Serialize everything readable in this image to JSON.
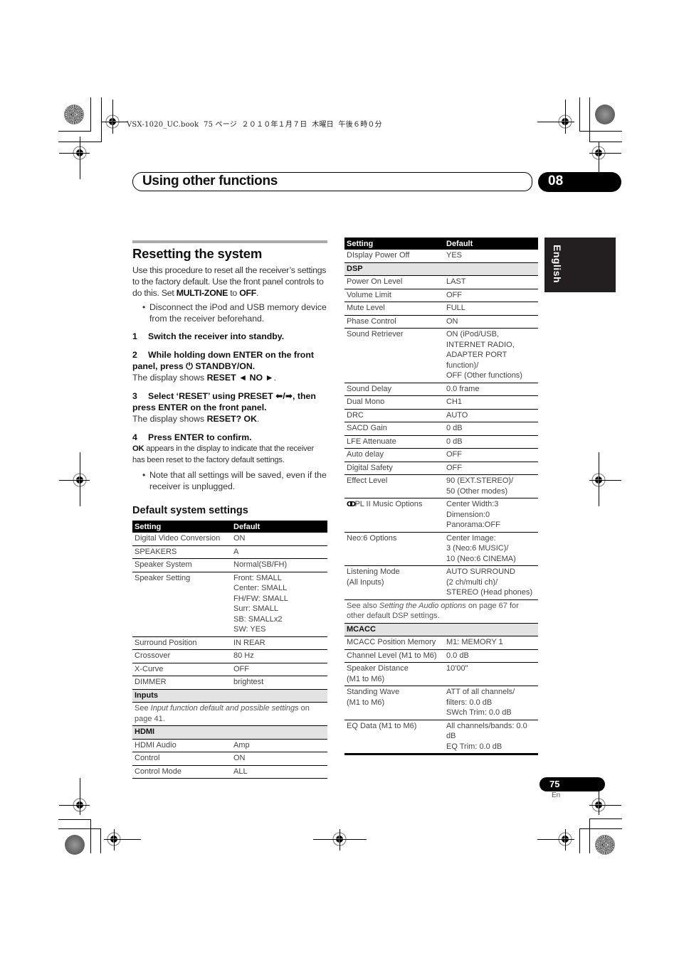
{
  "print_slug": "VSX-1020_UC.book  75 ページ  ２０１０年１月７日  木曜日  午後６時０分",
  "header": {
    "chapter_title": "Using other functions",
    "chapter_number": "08"
  },
  "language_tab": "English",
  "reset_section": {
    "title": "Resetting the system",
    "intro_parts": [
      "Use this procedure to reset all the receiver’s settings to the factory default. Use the front panel controls to do this. Set ",
      "MULTI-ZONE",
      " to ",
      "OFF",
      "."
    ],
    "bullet1": "Disconnect the iPod and USB memory device from the receiver beforehand.",
    "steps": [
      {
        "num": "1",
        "text": "Switch the receiver into standby."
      },
      {
        "num": "2",
        "text": "While holding down ENTER on the front panel, press ⏻ STANDBY/ON.",
        "result_prefix": "The display shows ",
        "result_bold": "RESET ◄ NO ►",
        "result_suffix": "."
      },
      {
        "num": "3",
        "text": "Select ‘RESET’ using PRESET ⬅/➡, then press ENTER on the front panel.",
        "result_prefix": "The display shows ",
        "result_bold": "RESET? OK",
        "result_suffix": "."
      },
      {
        "num": "4",
        "text": "Press ENTER to confirm.",
        "result_bold": "OK",
        "result_suffix": " appears in the display to indicate that the receiver has been reset to the factory default settings."
      }
    ],
    "bullet2": "Note that all settings will be saved, even if the receiver is unplugged."
  },
  "defaults_section": {
    "title": "Default system settings",
    "col_setting": "Setting",
    "col_default": "Default",
    "left_rows": [
      {
        "setting": "Digital Video Conversion",
        "default": "ON"
      },
      {
        "setting": "SPEAKERS",
        "default": "A"
      },
      {
        "setting": "Speaker System",
        "default": "Normal(SB/FH)"
      },
      {
        "setting": "Speaker Setting",
        "default": "Front: SMALL\nCenter: SMALL\nFH/FW: SMALL\nSurr: SMALL\nSB: SMALLx2\nSW: YES"
      },
      {
        "setting": "Surround Position",
        "default": "IN REAR"
      },
      {
        "setting": "Crossover",
        "default": "80 Hz"
      },
      {
        "setting": "X-Curve",
        "default": "OFF"
      },
      {
        "setting": "DIMMER",
        "default": "brightest"
      }
    ],
    "inputs_group": "Inputs",
    "inputs_note": {
      "prefix": "See ",
      "italic": "Input function default and possible settings",
      "suffix": " on page 41."
    },
    "hdmi_group": "HDMI",
    "hdmi_rows": [
      {
        "setting": "HDMI Audio",
        "default": "Amp"
      },
      {
        "setting": "Control",
        "default": "ON"
      },
      {
        "setting": "Control Mode",
        "default": "ALL"
      }
    ],
    "right_first_row": {
      "setting": "DIsplay Power Off",
      "default": "YES"
    },
    "dsp_group": "DSP",
    "dsp_rows": [
      {
        "setting": "Power On Level",
        "default": "LAST"
      },
      {
        "setting": "Volume Limit",
        "default": "OFF"
      },
      {
        "setting": "Mute Level",
        "default": "FULL"
      },
      {
        "setting": "Phase Control",
        "default": "ON"
      },
      {
        "setting": "Sound Retriever",
        "default": "ON (iPod/USB, INTERNET RADIO, ADAPTER PORT function)/\nOFF (Other functions)"
      },
      {
        "setting": "Sound Delay",
        "default": "0.0 frame"
      },
      {
        "setting": "Dual Mono",
        "default": "CH1"
      },
      {
        "setting": "DRC",
        "default": "AUTO"
      },
      {
        "setting": "SACD Gain",
        "default": "0 dB"
      },
      {
        "setting": "LFE Attenuate",
        "default": "0 dB"
      },
      {
        "setting": "Auto delay",
        "default": "OFF"
      },
      {
        "setting": "Digital Safety",
        "default": "OFF"
      },
      {
        "setting": "Effect Level",
        "default": "90 (EXT.STEREO)/\n50 (Other modes)"
      },
      {
        "setting": "PL II Music Options",
        "default": "Center Width:3\nDimension:0\nPanorama:OFF",
        "icon": "dolby-double-d-icon"
      },
      {
        "setting": "Neo:6 Options",
        "default": "Center Image:\n3 (Neo:6 MUSIC)/\n10 (Neo:6 CINEMA)"
      },
      {
        "setting": "Listening Mode\n(All Inputs)",
        "default": "AUTO SURROUND\n(2 ch/multi ch)/\nSTEREO (Head phones)"
      }
    ],
    "dsp_note": {
      "prefix": "See also ",
      "italic": "Setting the Audio options",
      "suffix": " on page 67 for other default DSP settings."
    },
    "mcacc_group": "MCACC",
    "mcacc_rows": [
      {
        "setting": "MCACC Position Memory",
        "default": "M1: MEMORY 1"
      },
      {
        "setting": "Channel Level (M1 to M6)",
        "default": "0.0 dB"
      },
      {
        "setting": "Speaker Distance\n(M1 to M6)",
        "default": "10'00\""
      },
      {
        "setting": "Standing Wave\n(M1 to M6)",
        "default": "ATT of all channels/\nfilters: 0.0 dB\nSWch Trim: 0.0 dB"
      },
      {
        "setting": "EQ Data (M1 to M6)",
        "default": "All channels/bands: 0.0 dB\nEQ Trim: 0.0 dB"
      }
    ]
  },
  "footer": {
    "page_number": "75",
    "page_lang": "En"
  }
}
